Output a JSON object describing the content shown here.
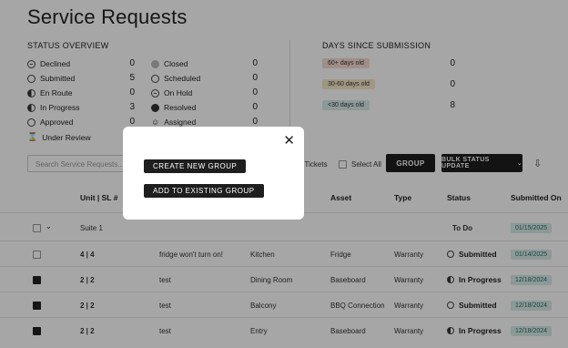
{
  "page_title": "Service Requests",
  "status_overview": {
    "heading": "STATUS OVERVIEW",
    "left": [
      {
        "label": "Declined",
        "value": "0",
        "icon": "dash-circle-icon"
      },
      {
        "label": "Submitted",
        "value": "5",
        "icon": "empty-circle-icon"
      },
      {
        "label": "En Route",
        "value": "0",
        "icon": "quarter-circle-icon"
      },
      {
        "label": "In Progress",
        "value": "3",
        "icon": "half-circle-icon"
      },
      {
        "label": "Approved",
        "value": "0",
        "icon": "empty-circle-icon"
      },
      {
        "label": "Under Review",
        "value": "",
        "icon": "hourglass-icon"
      }
    ],
    "right": [
      {
        "label": "Closed",
        "value": "0",
        "icon": "gray-circle-icon"
      },
      {
        "label": "Scheduled",
        "value": "0",
        "icon": "empty-circle-icon"
      },
      {
        "label": "On Hold",
        "value": "0",
        "icon": "dash-circle-icon"
      },
      {
        "label": "Resolved",
        "value": "0",
        "icon": "full-circle-icon"
      },
      {
        "label": "Assigned",
        "value": "0",
        "icon": "person-icon"
      }
    ]
  },
  "days_since": {
    "heading": "DAYS SINCE SUBMISSION",
    "items": [
      {
        "label": "60+ days old",
        "value": "0",
        "color": "#f6dcd3"
      },
      {
        "label": "30-60 days old",
        "value": "0",
        "color": "#f6e6c6"
      },
      {
        "label": "<30 days old",
        "value": "8",
        "color": "#d6ece9"
      }
    ]
  },
  "toolbar": {
    "search_placeholder": "Search Service Requests...",
    "tickets_label": "d Tickets",
    "select_all": "Select All",
    "group_button": "GROUP",
    "bulk_button": "BULK STATUS UPDATE"
  },
  "table": {
    "headers": [
      "Unit | SL #",
      "Asset",
      "Type",
      "Status",
      "Submitted On"
    ],
    "group": {
      "name": "Suite 1",
      "status": "To Do",
      "date": "01/15/2025"
    },
    "rows": [
      {
        "unit": "4 | 4",
        "desc": "fridge won't turn on!",
        "location": "Kitchen",
        "asset": "Fridge",
        "type": "Warranty",
        "status": "Submitted",
        "date": "01/14/2025",
        "checked": false
      },
      {
        "unit": "2 | 2",
        "desc": "test",
        "location": "Dining Room",
        "asset": "Baseboard",
        "type": "Warranty",
        "status": "In Progress",
        "date": "12/18/2024",
        "checked": true
      },
      {
        "unit": "2 | 2",
        "desc": "test",
        "location": "Balcony",
        "asset": "BBQ Connection",
        "type": "Warranty",
        "status": "Submitted",
        "date": "12/18/2024",
        "checked": true
      },
      {
        "unit": "2 | 2",
        "desc": "test",
        "location": "Entry",
        "asset": "Baseboard",
        "type": "Warranty",
        "status": "In Progress",
        "date": "12/18/2024",
        "checked": true
      }
    ]
  },
  "modal": {
    "create_label": "CREATE NEW GROUP",
    "add_label": "ADD TO EXISTING GROUP",
    "close_glyph": "✕"
  }
}
